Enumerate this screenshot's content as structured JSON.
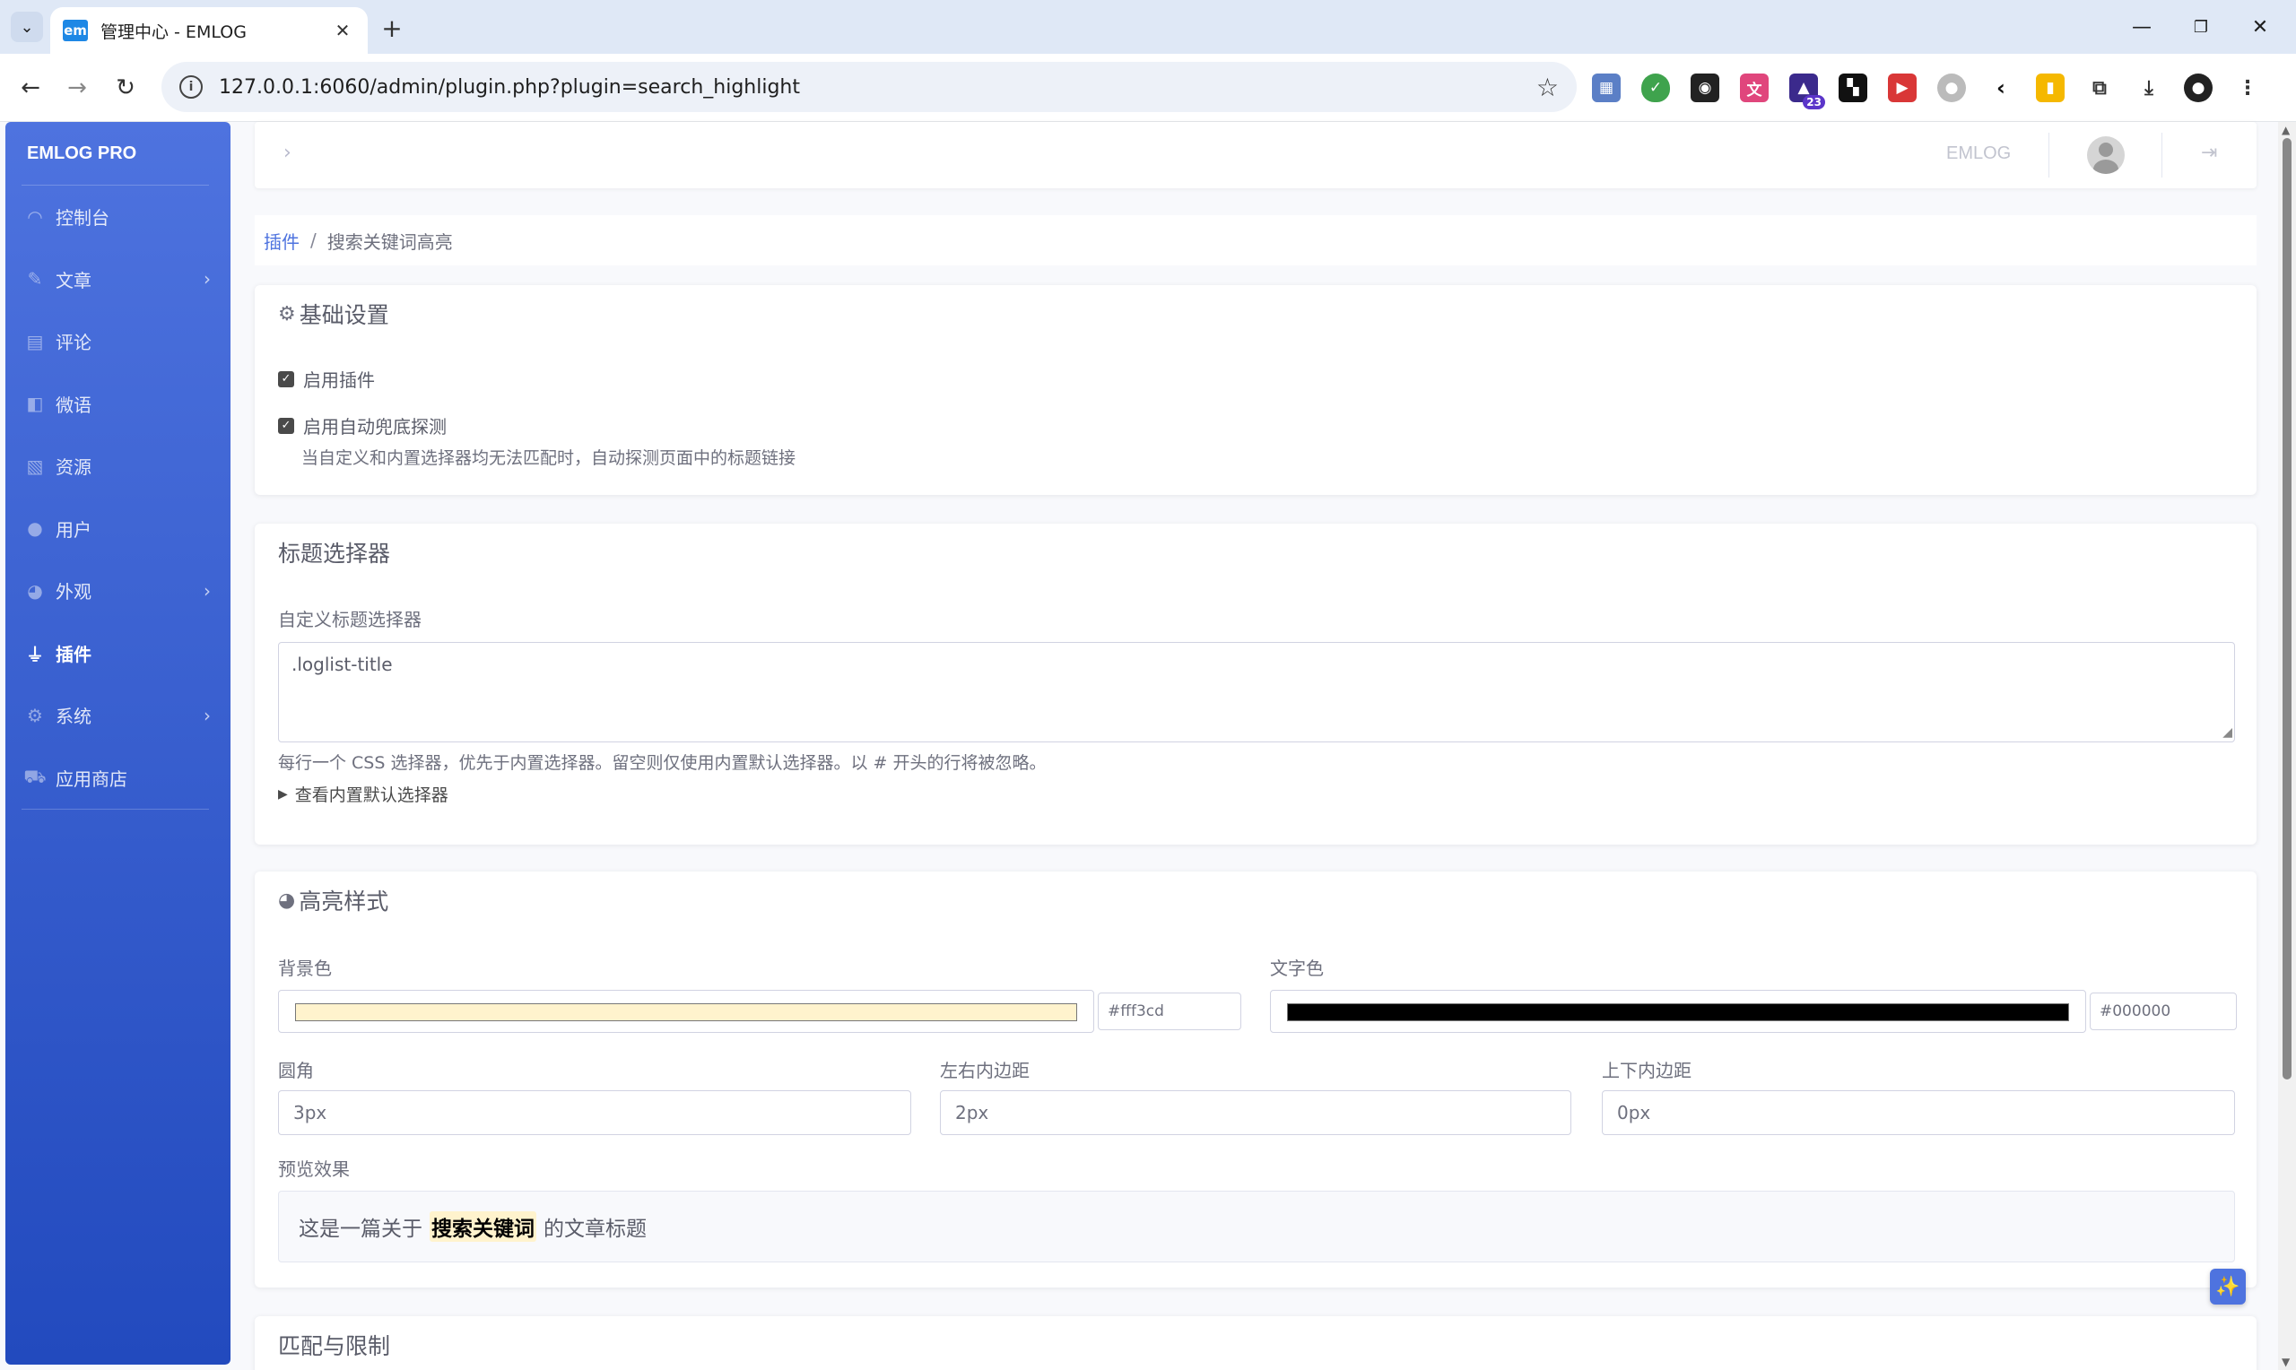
{
  "browser": {
    "tab_title": "管理中心 - EMLOG",
    "tab_favicon_text": "em",
    "url": "127.0.0.1:6060/admin/plugin.php?plugin=search_highlight",
    "extension_badge": "23"
  },
  "sidebar": {
    "brand": "EMLOG PRO",
    "items": [
      {
        "label": "控制台",
        "icon": "dashboard-icon",
        "has_children": false,
        "active": false
      },
      {
        "label": "文章",
        "icon": "pencil-icon",
        "has_children": true,
        "active": false
      },
      {
        "label": "评论",
        "icon": "comment-icon",
        "has_children": false,
        "active": false
      },
      {
        "label": "微语",
        "icon": "note-icon",
        "has_children": false,
        "active": false
      },
      {
        "label": "资源",
        "icon": "image-icon",
        "has_children": false,
        "active": false
      },
      {
        "label": "用户",
        "icon": "user-icon",
        "has_children": false,
        "active": false
      },
      {
        "label": "外观",
        "icon": "palette-icon",
        "has_children": true,
        "active": false
      },
      {
        "label": "插件",
        "icon": "plug-icon",
        "has_children": false,
        "active": true
      },
      {
        "label": "系统",
        "icon": "gear-icon",
        "has_children": true,
        "active": false
      },
      {
        "label": "应用商店",
        "icon": "cart-icon",
        "has_children": false,
        "active": false
      }
    ]
  },
  "topbar": {
    "brand": "EMLOG"
  },
  "breadcrumb": {
    "parent": "插件",
    "current": "搜索关键词高亮"
  },
  "basic": {
    "title": "基础设置",
    "enable_plugin": {
      "label": "启用插件",
      "checked": true
    },
    "auto_detect": {
      "label": "启用自动兜底探测",
      "checked": true
    },
    "auto_detect_hint": "当自定义和内置选择器均无法匹配时，自动探测页面中的标题链接"
  },
  "selector": {
    "title": "标题选择器",
    "field_label": "自定义标题选择器",
    "value": ".loglist-title",
    "hint": "每行一个 CSS 选择器，优先于内置选择器。留空则仅使用内置默认选择器。以 # 开头的行将被忽略。",
    "details_label": "查看内置默认选择器"
  },
  "style": {
    "title": "高亮样式",
    "bg_label": "背景色",
    "bg_color": "#fff3cd",
    "fg_label": "文字色",
    "fg_color": "#000000",
    "radius_label": "圆角",
    "radius_value": "3px",
    "padding_x_label": "左右内边距",
    "padding_x_value": "2px",
    "padding_y_label": "上下内边距",
    "padding_y_value": "0px",
    "preview_label": "预览效果",
    "preview_before": "这是一篇关于",
    "preview_keyword": "搜索关键词",
    "preview_after": "的文章标题"
  },
  "matching": {
    "title": "匹配与限制"
  },
  "colors": {
    "sidebar_top": "#4e73df",
    "sidebar_bottom": "#224abe",
    "link": "#4e73df"
  }
}
